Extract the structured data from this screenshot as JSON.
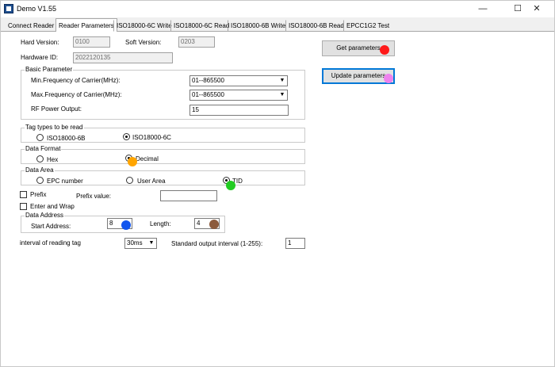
{
  "window": {
    "title": "Demo V1.55",
    "controls": {
      "minimize": "—",
      "maximize": "☐",
      "close": "✕"
    }
  },
  "tabs": [
    {
      "label": "Connect Reader",
      "active": false
    },
    {
      "label": "Reader Parameters",
      "active": true
    },
    {
      "label": "ISO18000-6C Write",
      "active": false
    },
    {
      "label": "ISO18000-6C Read",
      "active": false
    },
    {
      "label": "ISO18000-6B Write",
      "active": false
    },
    {
      "label": "ISO18000-6B Read",
      "active": false
    },
    {
      "label": "EPCC1G2 Test",
      "active": false
    }
  ],
  "version": {
    "hard_label": "Hard Version:",
    "hard_value": "0100",
    "soft_label": "Soft Version:",
    "soft_value": "0203",
    "hwid_label": "Hardware ID:",
    "hwid_value": "2022120135"
  },
  "basic": {
    "title": "Basic Parameter",
    "min_label": "Min.Frequency of Carrier(MHz):",
    "min_value": "01--865500",
    "max_label": "Max.Frequency of Carrier(MHz):",
    "max_value": "01--865500",
    "rf_label": "RF Power Output:",
    "rf_value": "15"
  },
  "tag_types": {
    "title": "Tag types to be read",
    "opt1": "ISO18000-6B",
    "opt2": "ISO18000-6C",
    "selected": "ISO18000-6C"
  },
  "data_format": {
    "title": "Data Format",
    "opt1": "Hex",
    "opt2": "Decimal",
    "selected": "Decimal"
  },
  "data_area": {
    "title": "Data Area",
    "opt1": "EPC number",
    "opt2": "User Area",
    "opt3": "TID",
    "selected": "TID"
  },
  "prefix": {
    "label": "Prefix",
    "checked": false,
    "value_label": "Prefix value:",
    "value": ""
  },
  "enter_wrap": {
    "label": "Enter and Wrap",
    "checked": false
  },
  "data_address": {
    "title": "Data Address",
    "start_label": "Start Address:",
    "start_value": "8",
    "length_label": "Length:",
    "length_value": "4"
  },
  "interval": {
    "label": "interval of reading tag",
    "value": "30ms",
    "std_label": "Standard output interval (1-255):",
    "std_value": "1"
  },
  "buttons": {
    "get": "Get parameters",
    "update": "Update parameters"
  },
  "markers": {
    "get_color": "#ff1a1a",
    "update_color": "#ee82ee",
    "decimal_color": "#ffa500",
    "tid_color": "#22cc22",
    "start_color": "#1155ee",
    "length_color": "#8b5a3c"
  }
}
